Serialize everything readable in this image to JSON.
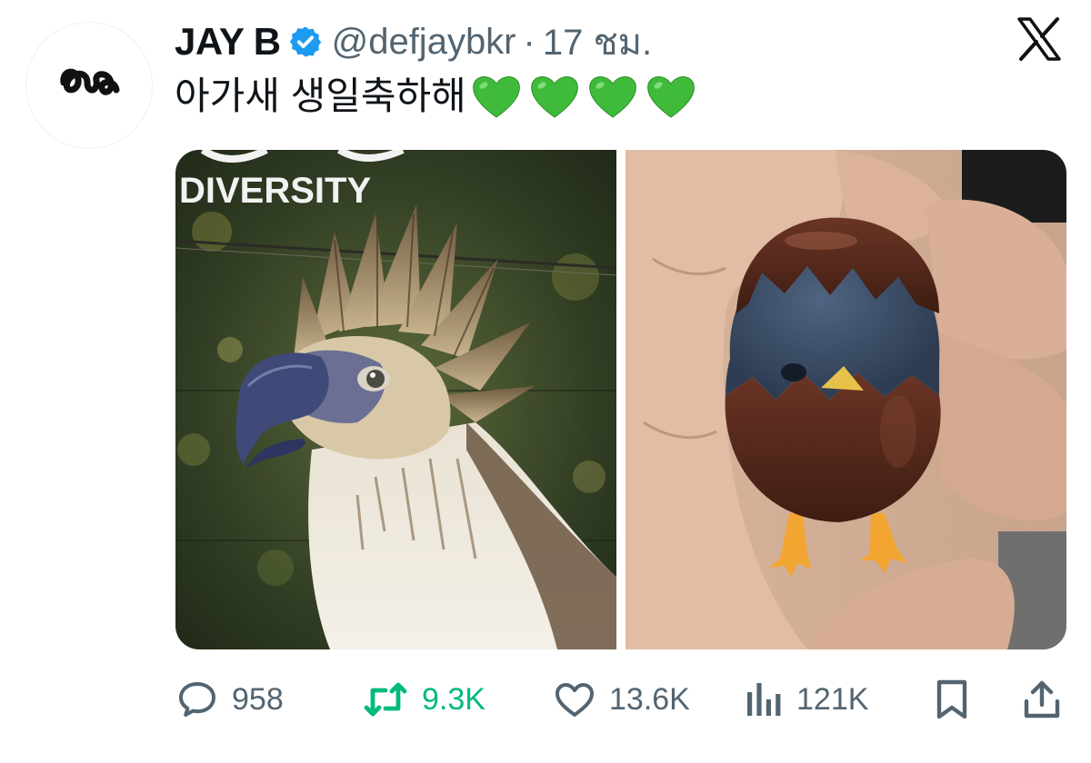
{
  "author": {
    "display_name": "JAY B",
    "handle": "@defjaybkr",
    "separator": "·",
    "time": "17 ชม.",
    "verified": true,
    "avatar_icon": "squiggle-logo-icon"
  },
  "tweet": {
    "text": "아가새 생일축하해",
    "emoji_hearts": [
      "green-heart",
      "green-heart",
      "green-heart",
      "green-heart"
    ],
    "heart_color": "#3fba3a"
  },
  "media": [
    {
      "name": "eagle-photo",
      "overlay_text": "DIVERSITY"
    },
    {
      "name": "chick-figure-photo"
    }
  ],
  "actions": {
    "reply_count": "958",
    "repost_count": "9.3K",
    "like_count": "13.6K",
    "view_count": "121K"
  },
  "colors": {
    "text": "#0f1419",
    "muted": "#536471",
    "repost_green": "#00ba7c",
    "verified_blue": "#1d9bf0"
  },
  "brand": "X"
}
